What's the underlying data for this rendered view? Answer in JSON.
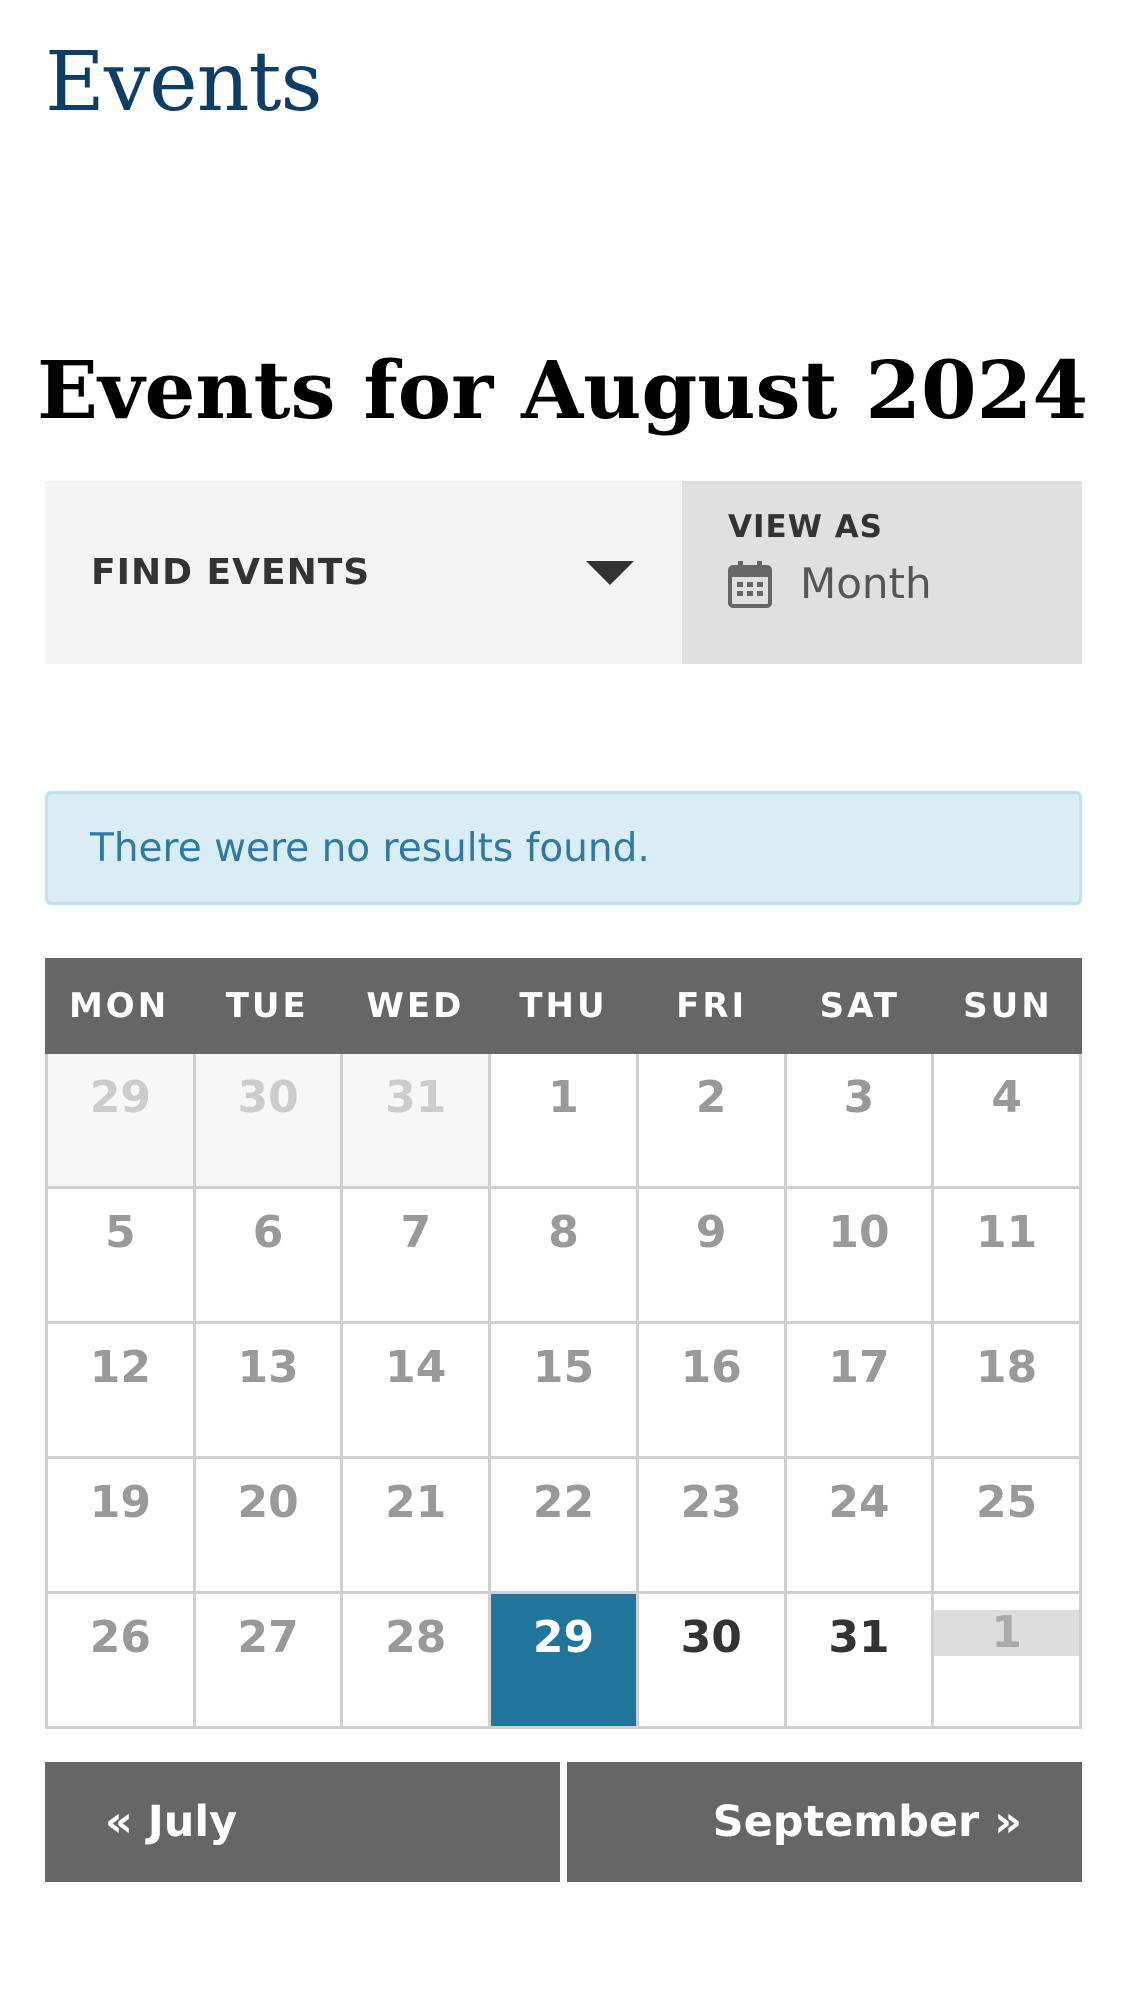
{
  "site": {
    "title": "Events"
  },
  "heading": "Events for August 2024",
  "filter_bar": {
    "find_label": "FIND EVENTS",
    "view_as_label": "VIEW AS",
    "view_value": "Month",
    "icons": {
      "dropdown": "caret-down-icon",
      "view": "calendar-icon"
    }
  },
  "notice": {
    "text": "There were no results found."
  },
  "calendar": {
    "weekdays": [
      "MON",
      "TUE",
      "WED",
      "THU",
      "FRI",
      "SAT",
      "SUN"
    ],
    "weeks": [
      [
        {
          "d": "29",
          "s": "other"
        },
        {
          "d": "30",
          "s": "other"
        },
        {
          "d": "31",
          "s": "other"
        },
        {
          "d": "1",
          "s": "past"
        },
        {
          "d": "2",
          "s": "past"
        },
        {
          "d": "3",
          "s": "past"
        },
        {
          "d": "4",
          "s": "past"
        }
      ],
      [
        {
          "d": "5",
          "s": "past"
        },
        {
          "d": "6",
          "s": "past"
        },
        {
          "d": "7",
          "s": "past"
        },
        {
          "d": "8",
          "s": "past"
        },
        {
          "d": "9",
          "s": "past"
        },
        {
          "d": "10",
          "s": "past"
        },
        {
          "d": "11",
          "s": "past"
        }
      ],
      [
        {
          "d": "12",
          "s": "past"
        },
        {
          "d": "13",
          "s": "past"
        },
        {
          "d": "14",
          "s": "past"
        },
        {
          "d": "15",
          "s": "past"
        },
        {
          "d": "16",
          "s": "past"
        },
        {
          "d": "17",
          "s": "past"
        },
        {
          "d": "18",
          "s": "past"
        }
      ],
      [
        {
          "d": "19",
          "s": "past"
        },
        {
          "d": "20",
          "s": "past"
        },
        {
          "d": "21",
          "s": "past"
        },
        {
          "d": "22",
          "s": "past"
        },
        {
          "d": "23",
          "s": "past"
        },
        {
          "d": "24",
          "s": "past"
        },
        {
          "d": "25",
          "s": "past"
        }
      ],
      [
        {
          "d": "26",
          "s": "past"
        },
        {
          "d": "27",
          "s": "past"
        },
        {
          "d": "28",
          "s": "past"
        },
        {
          "d": "29",
          "s": "today"
        },
        {
          "d": "30",
          "s": "future"
        },
        {
          "d": "31",
          "s": "future"
        },
        {
          "d": "1",
          "s": "next"
        }
      ]
    ]
  },
  "nav": {
    "prev_label": "« July",
    "next_label": "September »"
  },
  "colors": {
    "title": "#0d3f66",
    "today": "#21759b",
    "header_bg": "#666666",
    "notice_bg": "#daedf5",
    "notice_text": "#2f7aa3"
  }
}
